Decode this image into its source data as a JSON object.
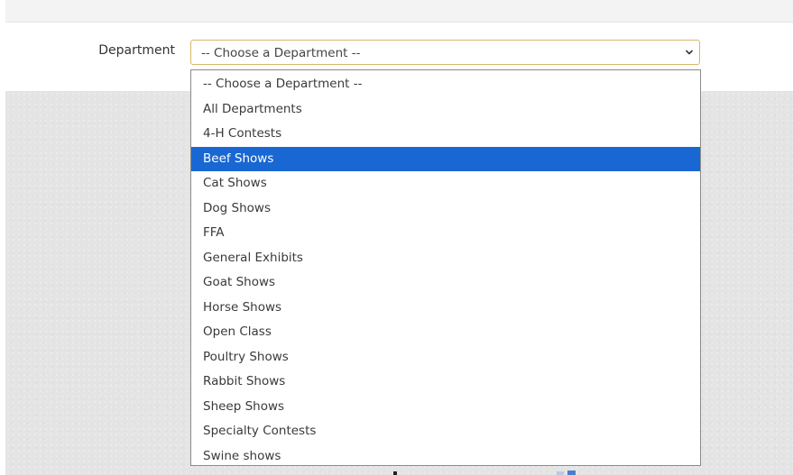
{
  "form": {
    "department_label": "Department",
    "department_select": {
      "selected_value": "-- Choose a Department --",
      "highlighted_option": "Beef Shows",
      "options": [
        "-- Choose a Department --",
        "All Departments",
        "4-H Contests",
        "Beef Shows",
        "Cat Shows",
        "Dog Shows",
        "FFA",
        "General Exhibits",
        "Goat Shows",
        "Horse Shows",
        "Open Class",
        "Poultry Shows",
        "Rabbit Shows",
        "Sheep Shows",
        "Specialty Contests",
        "Swine shows"
      ]
    }
  },
  "colors": {
    "highlight": "#1967d2",
    "select_border": "#d9b66b",
    "background_gray": "#e4e4e4"
  },
  "icons": {
    "select_arrow": "chevron-down-icon"
  }
}
